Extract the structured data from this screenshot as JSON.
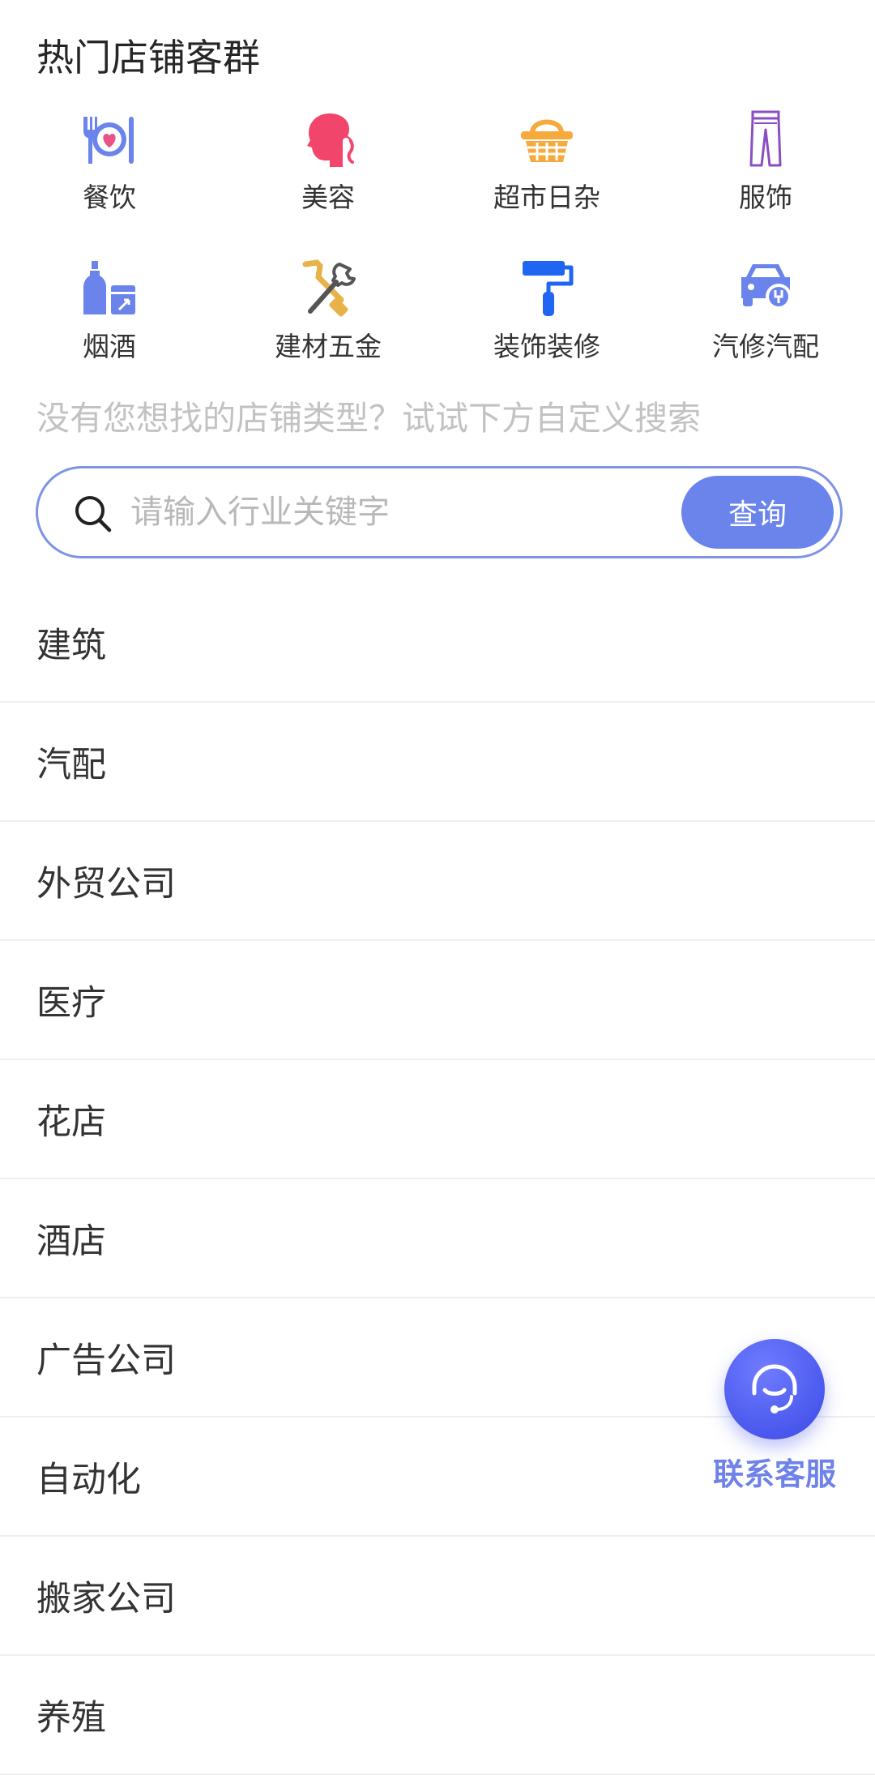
{
  "header": {
    "title": "热门店铺客群"
  },
  "categories": [
    {
      "label": "餐饮",
      "icon": "dining-icon",
      "color": "#6a84ec"
    },
    {
      "label": "美容",
      "icon": "beauty-icon",
      "color": "#f2456b"
    },
    {
      "label": "超市日杂",
      "icon": "supermarket-basket-icon",
      "color": "#f7a93b"
    },
    {
      "label": "服饰",
      "icon": "clothing-pants-icon",
      "color": "#8a4fc2"
    },
    {
      "label": "烟酒",
      "icon": "tobacco-liquor-icon",
      "color": "#6a84ec"
    },
    {
      "label": "建材五金",
      "icon": "hardware-tools-icon",
      "color": "#e7b24a"
    },
    {
      "label": "装饰装修",
      "icon": "paint-roller-icon",
      "color": "#1f66f2"
    },
    {
      "label": "汽修汽配",
      "icon": "car-repair-icon",
      "color": "#6a84ec"
    }
  ],
  "search": {
    "hint": "没有您想找的店铺类型？试试下方自定义搜索",
    "placeholder": "请输入行业关键字",
    "value": "",
    "button_label": "查询",
    "accent": "#6a84ec"
  },
  "industries": [
    "建筑",
    "汽配",
    "外贸公司",
    "医疗",
    "花店",
    "酒店",
    "广告公司",
    "自动化",
    "搬家公司",
    "养殖"
  ],
  "support": {
    "label": "联系客服",
    "icon": "customer-service-headset-icon"
  }
}
